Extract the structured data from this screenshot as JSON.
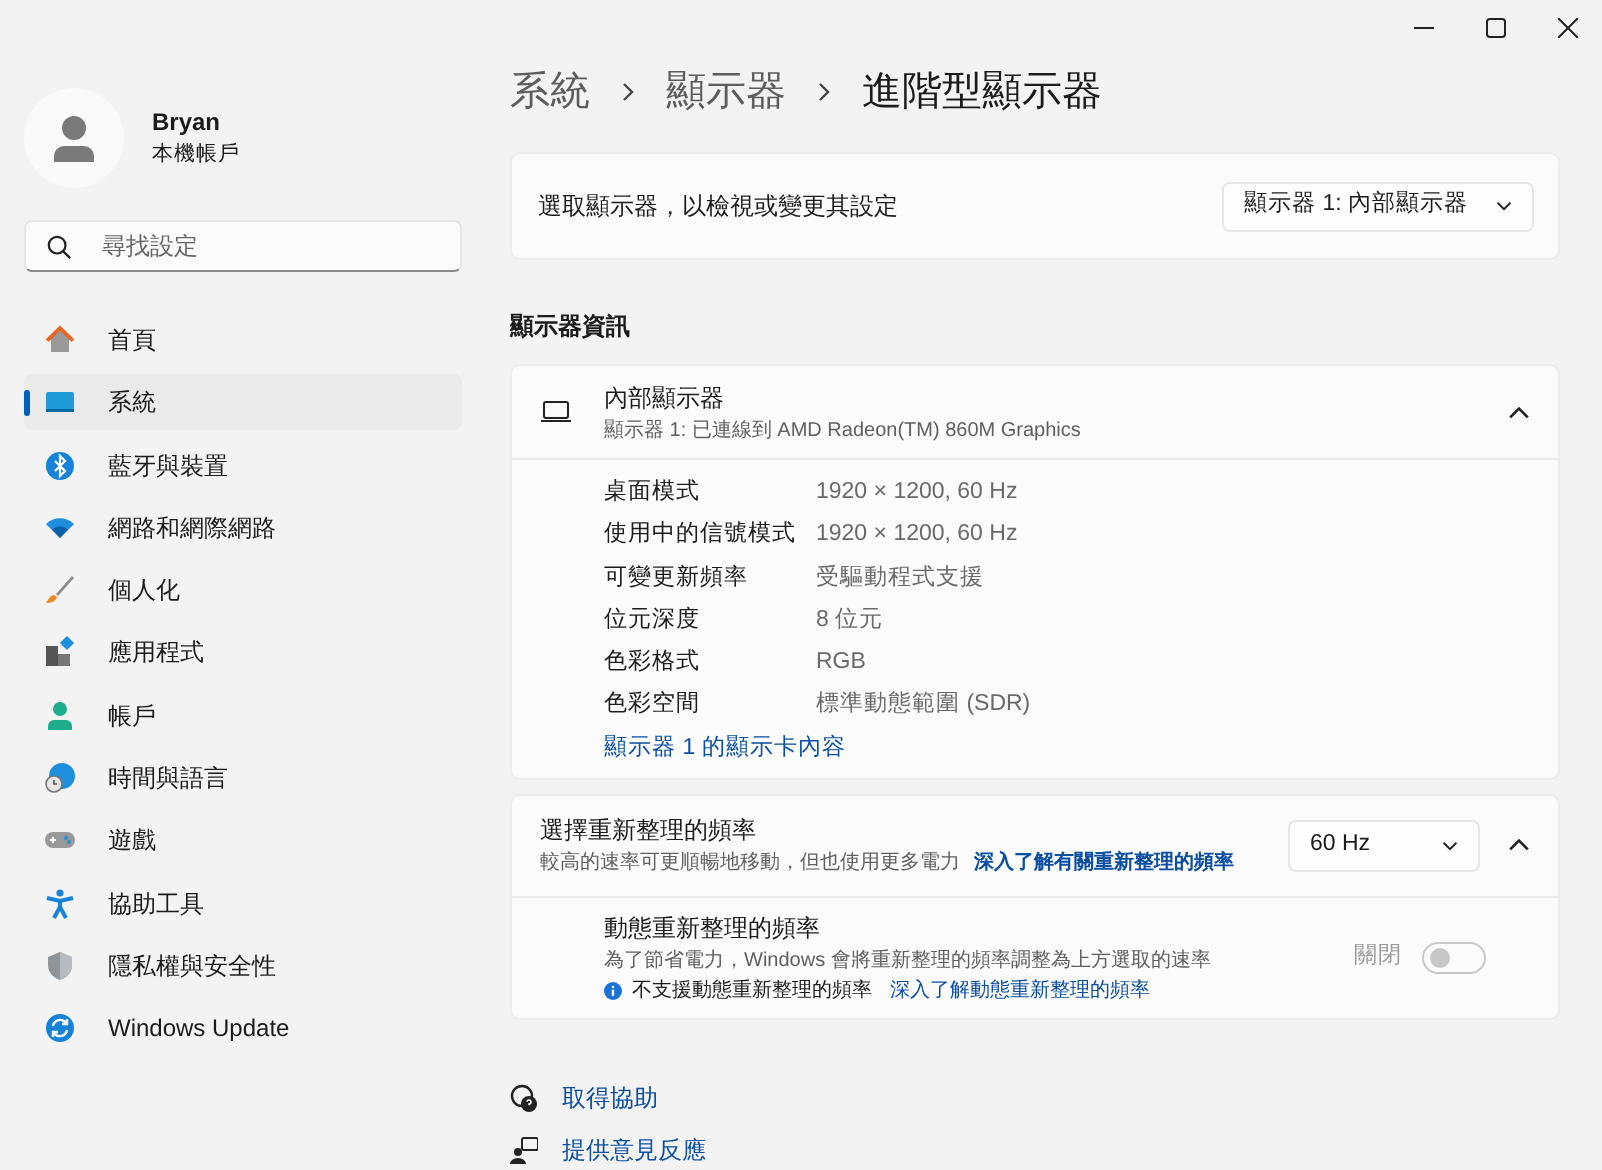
{
  "profile": {
    "name": "Bryan",
    "subtitle": "本機帳戶"
  },
  "search": {
    "placeholder": "尋找設定"
  },
  "sidebar": {
    "items": [
      {
        "label": "首頁",
        "kind": "home",
        "selected": false
      },
      {
        "label": "系統",
        "kind": "system",
        "selected": true
      },
      {
        "label": "藍牙與裝置",
        "kind": "bluetooth",
        "selected": false
      },
      {
        "label": "網路和網際網路",
        "kind": "network",
        "selected": false
      },
      {
        "label": "個人化",
        "kind": "brush",
        "selected": false
      },
      {
        "label": "應用程式",
        "kind": "apps",
        "selected": false
      },
      {
        "label": "帳戶",
        "kind": "account",
        "selected": false
      },
      {
        "label": "時間與語言",
        "kind": "time",
        "selected": false
      },
      {
        "label": "遊戲",
        "kind": "gaming",
        "selected": false
      },
      {
        "label": "協助工具",
        "kind": "accessibility",
        "selected": false
      },
      {
        "label": "隱私權與安全性",
        "kind": "privacy",
        "selected": false
      },
      {
        "label": "Windows Update",
        "kind": "update",
        "selected": false
      }
    ]
  },
  "breadcrumb": [
    {
      "label": "系統",
      "selected": false
    },
    {
      "label": "顯示器",
      "selected": false
    },
    {
      "label": "進階型顯示器",
      "selected": true
    }
  ],
  "display_select": {
    "label": "選取顯示器，以檢視或變更其設定",
    "value": "顯示器 1: 內部顯示器"
  },
  "info_section": {
    "heading": "顯示器資訊",
    "title": "內部顯示器",
    "subtitle": "顯示器 1: 已連線到 AMD Radeon(TM) 860M Graphics",
    "expanded": true,
    "rows": [
      {
        "label": "桌面模式",
        "value": "1920 × 1200, 60 Hz"
      },
      {
        "label": "使用中的信號模式",
        "value": "1920 × 1200, 60 Hz"
      },
      {
        "label": "可變更新頻率",
        "value": "受驅動程式支援"
      },
      {
        "label": "位元深度",
        "value": "8 位元"
      },
      {
        "label": "色彩格式",
        "value": "RGB"
      },
      {
        "label": "色彩空間",
        "value": "標準動態範圍 (SDR)"
      }
    ],
    "link": "顯示器 1 的顯示卡內容"
  },
  "refresh": {
    "title": "選擇重新整理的頻率",
    "description": "較高的速率可更順暢地移動，但也使用更多電力",
    "link": "深入了解有關重新整理的頻率",
    "value": "60 Hz",
    "expanded": true,
    "dynamic": {
      "title": "動態重新整理的頻率",
      "description": "為了節省電力，Windows 會將重新整理的頻率調整為上方選取的速率",
      "state_label": "關閉",
      "on": false,
      "disabled": true,
      "note": "不支援動態重新整理的頻率",
      "note_link": "深入了解動態重新整理的頻率"
    }
  },
  "footer_links": [
    {
      "label": "取得協助",
      "kind": "help"
    },
    {
      "label": "提供意見反應",
      "kind": "feedback"
    }
  ]
}
